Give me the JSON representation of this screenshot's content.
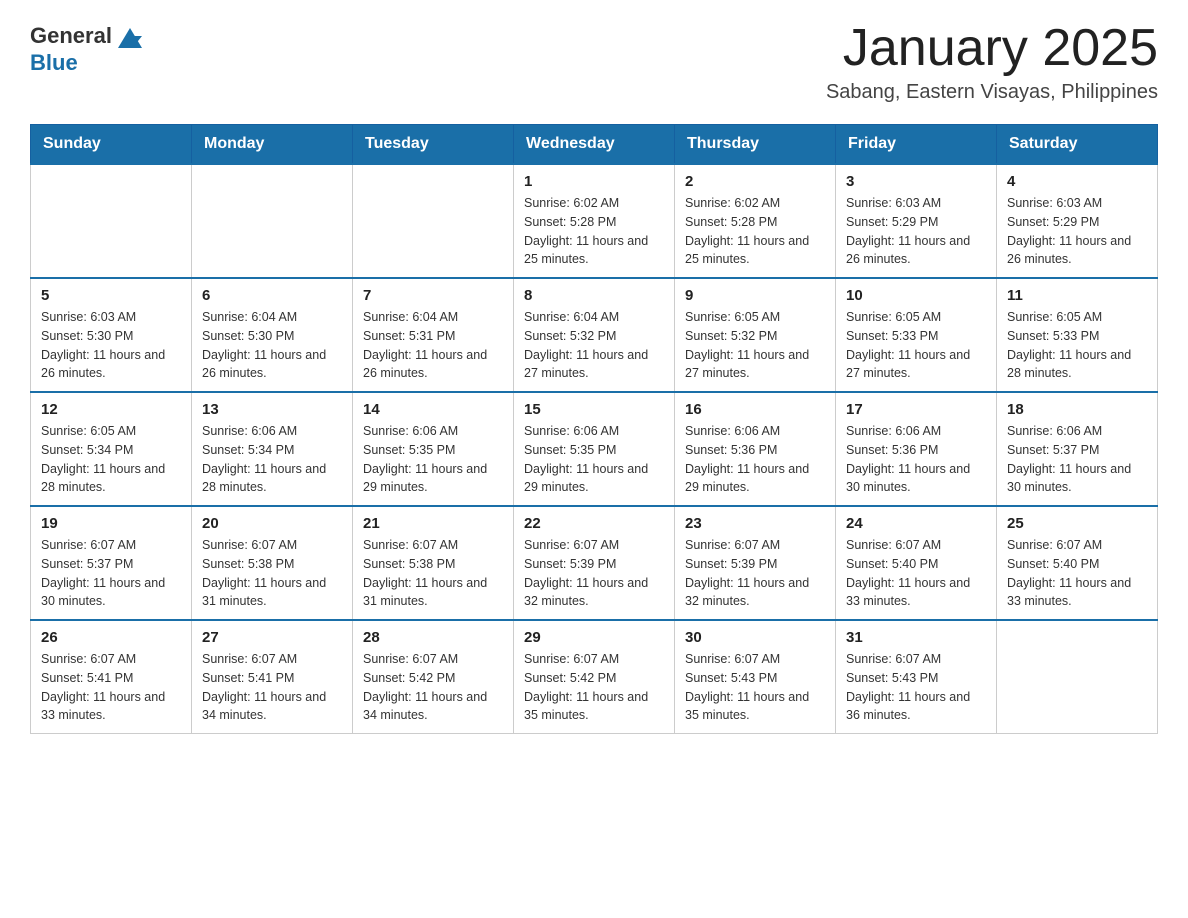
{
  "header": {
    "logo": {
      "general": "General",
      "blue": "Blue",
      "aria": "GeneralBlue Logo"
    },
    "title": "January 2025",
    "subtitle": "Sabang, Eastern Visayas, Philippines"
  },
  "days_of_week": [
    "Sunday",
    "Monday",
    "Tuesday",
    "Wednesday",
    "Thursday",
    "Friday",
    "Saturday"
  ],
  "weeks": [
    [
      {
        "day": "",
        "sunrise": "",
        "sunset": "",
        "daylight": ""
      },
      {
        "day": "",
        "sunrise": "",
        "sunset": "",
        "daylight": ""
      },
      {
        "day": "",
        "sunrise": "",
        "sunset": "",
        "daylight": ""
      },
      {
        "day": "1",
        "sunrise": "Sunrise: 6:02 AM",
        "sunset": "Sunset: 5:28 PM",
        "daylight": "Daylight: 11 hours and 25 minutes."
      },
      {
        "day": "2",
        "sunrise": "Sunrise: 6:02 AM",
        "sunset": "Sunset: 5:28 PM",
        "daylight": "Daylight: 11 hours and 25 minutes."
      },
      {
        "day": "3",
        "sunrise": "Sunrise: 6:03 AM",
        "sunset": "Sunset: 5:29 PM",
        "daylight": "Daylight: 11 hours and 26 minutes."
      },
      {
        "day": "4",
        "sunrise": "Sunrise: 6:03 AM",
        "sunset": "Sunset: 5:29 PM",
        "daylight": "Daylight: 11 hours and 26 minutes."
      }
    ],
    [
      {
        "day": "5",
        "sunrise": "Sunrise: 6:03 AM",
        "sunset": "Sunset: 5:30 PM",
        "daylight": "Daylight: 11 hours and 26 minutes."
      },
      {
        "day": "6",
        "sunrise": "Sunrise: 6:04 AM",
        "sunset": "Sunset: 5:30 PM",
        "daylight": "Daylight: 11 hours and 26 minutes."
      },
      {
        "day": "7",
        "sunrise": "Sunrise: 6:04 AM",
        "sunset": "Sunset: 5:31 PM",
        "daylight": "Daylight: 11 hours and 26 minutes."
      },
      {
        "day": "8",
        "sunrise": "Sunrise: 6:04 AM",
        "sunset": "Sunset: 5:32 PM",
        "daylight": "Daylight: 11 hours and 27 minutes."
      },
      {
        "day": "9",
        "sunrise": "Sunrise: 6:05 AM",
        "sunset": "Sunset: 5:32 PM",
        "daylight": "Daylight: 11 hours and 27 minutes."
      },
      {
        "day": "10",
        "sunrise": "Sunrise: 6:05 AM",
        "sunset": "Sunset: 5:33 PM",
        "daylight": "Daylight: 11 hours and 27 minutes."
      },
      {
        "day": "11",
        "sunrise": "Sunrise: 6:05 AM",
        "sunset": "Sunset: 5:33 PM",
        "daylight": "Daylight: 11 hours and 28 minutes."
      }
    ],
    [
      {
        "day": "12",
        "sunrise": "Sunrise: 6:05 AM",
        "sunset": "Sunset: 5:34 PM",
        "daylight": "Daylight: 11 hours and 28 minutes."
      },
      {
        "day": "13",
        "sunrise": "Sunrise: 6:06 AM",
        "sunset": "Sunset: 5:34 PM",
        "daylight": "Daylight: 11 hours and 28 minutes."
      },
      {
        "day": "14",
        "sunrise": "Sunrise: 6:06 AM",
        "sunset": "Sunset: 5:35 PM",
        "daylight": "Daylight: 11 hours and 29 minutes."
      },
      {
        "day": "15",
        "sunrise": "Sunrise: 6:06 AM",
        "sunset": "Sunset: 5:35 PM",
        "daylight": "Daylight: 11 hours and 29 minutes."
      },
      {
        "day": "16",
        "sunrise": "Sunrise: 6:06 AM",
        "sunset": "Sunset: 5:36 PM",
        "daylight": "Daylight: 11 hours and 29 minutes."
      },
      {
        "day": "17",
        "sunrise": "Sunrise: 6:06 AM",
        "sunset": "Sunset: 5:36 PM",
        "daylight": "Daylight: 11 hours and 30 minutes."
      },
      {
        "day": "18",
        "sunrise": "Sunrise: 6:06 AM",
        "sunset": "Sunset: 5:37 PM",
        "daylight": "Daylight: 11 hours and 30 minutes."
      }
    ],
    [
      {
        "day": "19",
        "sunrise": "Sunrise: 6:07 AM",
        "sunset": "Sunset: 5:37 PM",
        "daylight": "Daylight: 11 hours and 30 minutes."
      },
      {
        "day": "20",
        "sunrise": "Sunrise: 6:07 AM",
        "sunset": "Sunset: 5:38 PM",
        "daylight": "Daylight: 11 hours and 31 minutes."
      },
      {
        "day": "21",
        "sunrise": "Sunrise: 6:07 AM",
        "sunset": "Sunset: 5:38 PM",
        "daylight": "Daylight: 11 hours and 31 minutes."
      },
      {
        "day": "22",
        "sunrise": "Sunrise: 6:07 AM",
        "sunset": "Sunset: 5:39 PM",
        "daylight": "Daylight: 11 hours and 32 minutes."
      },
      {
        "day": "23",
        "sunrise": "Sunrise: 6:07 AM",
        "sunset": "Sunset: 5:39 PM",
        "daylight": "Daylight: 11 hours and 32 minutes."
      },
      {
        "day": "24",
        "sunrise": "Sunrise: 6:07 AM",
        "sunset": "Sunset: 5:40 PM",
        "daylight": "Daylight: 11 hours and 33 minutes."
      },
      {
        "day": "25",
        "sunrise": "Sunrise: 6:07 AM",
        "sunset": "Sunset: 5:40 PM",
        "daylight": "Daylight: 11 hours and 33 minutes."
      }
    ],
    [
      {
        "day": "26",
        "sunrise": "Sunrise: 6:07 AM",
        "sunset": "Sunset: 5:41 PM",
        "daylight": "Daylight: 11 hours and 33 minutes."
      },
      {
        "day": "27",
        "sunrise": "Sunrise: 6:07 AM",
        "sunset": "Sunset: 5:41 PM",
        "daylight": "Daylight: 11 hours and 34 minutes."
      },
      {
        "day": "28",
        "sunrise": "Sunrise: 6:07 AM",
        "sunset": "Sunset: 5:42 PM",
        "daylight": "Daylight: 11 hours and 34 minutes."
      },
      {
        "day": "29",
        "sunrise": "Sunrise: 6:07 AM",
        "sunset": "Sunset: 5:42 PM",
        "daylight": "Daylight: 11 hours and 35 minutes."
      },
      {
        "day": "30",
        "sunrise": "Sunrise: 6:07 AM",
        "sunset": "Sunset: 5:43 PM",
        "daylight": "Daylight: 11 hours and 35 minutes."
      },
      {
        "day": "31",
        "sunrise": "Sunrise: 6:07 AM",
        "sunset": "Sunset: 5:43 PM",
        "daylight": "Daylight: 11 hours and 36 minutes."
      },
      {
        "day": "",
        "sunrise": "",
        "sunset": "",
        "daylight": ""
      }
    ]
  ]
}
